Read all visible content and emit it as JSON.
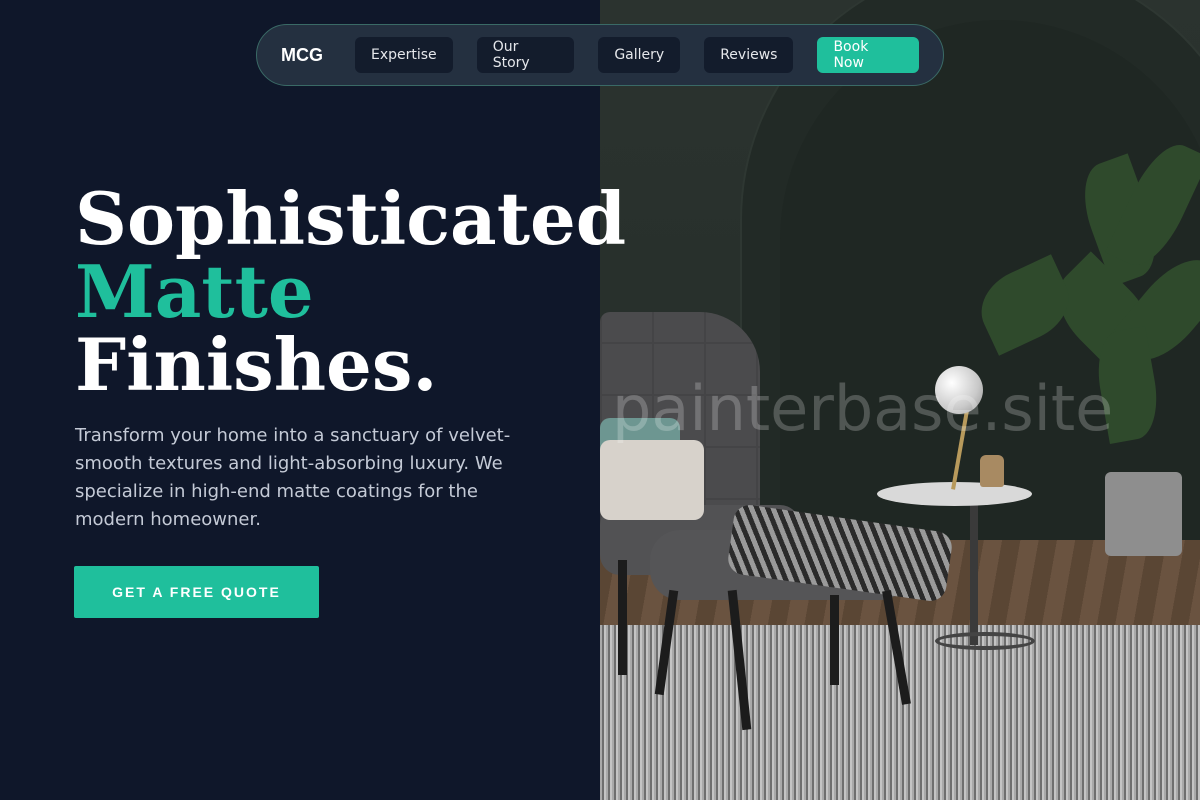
{
  "nav": {
    "logo": "MCG",
    "links": [
      "Expertise",
      "Our Story",
      "Gallery",
      "Reviews"
    ],
    "cta": "Book Now"
  },
  "hero": {
    "title_line1": "Sophisticated",
    "title_line2": "Matte",
    "title_line3": "Finishes.",
    "description": "Transform your home into a sanctuary of velvet-smooth textures and light-absorbing luxury. We specialize in high-end matte coatings for the modern homeowner.",
    "cta": "GET A FREE QUOTE"
  },
  "image": {
    "watermark": "painterbase.site"
  },
  "colors": {
    "background": "#0f172a",
    "accent": "#1fbf9c",
    "nav_bg": "#243040"
  }
}
